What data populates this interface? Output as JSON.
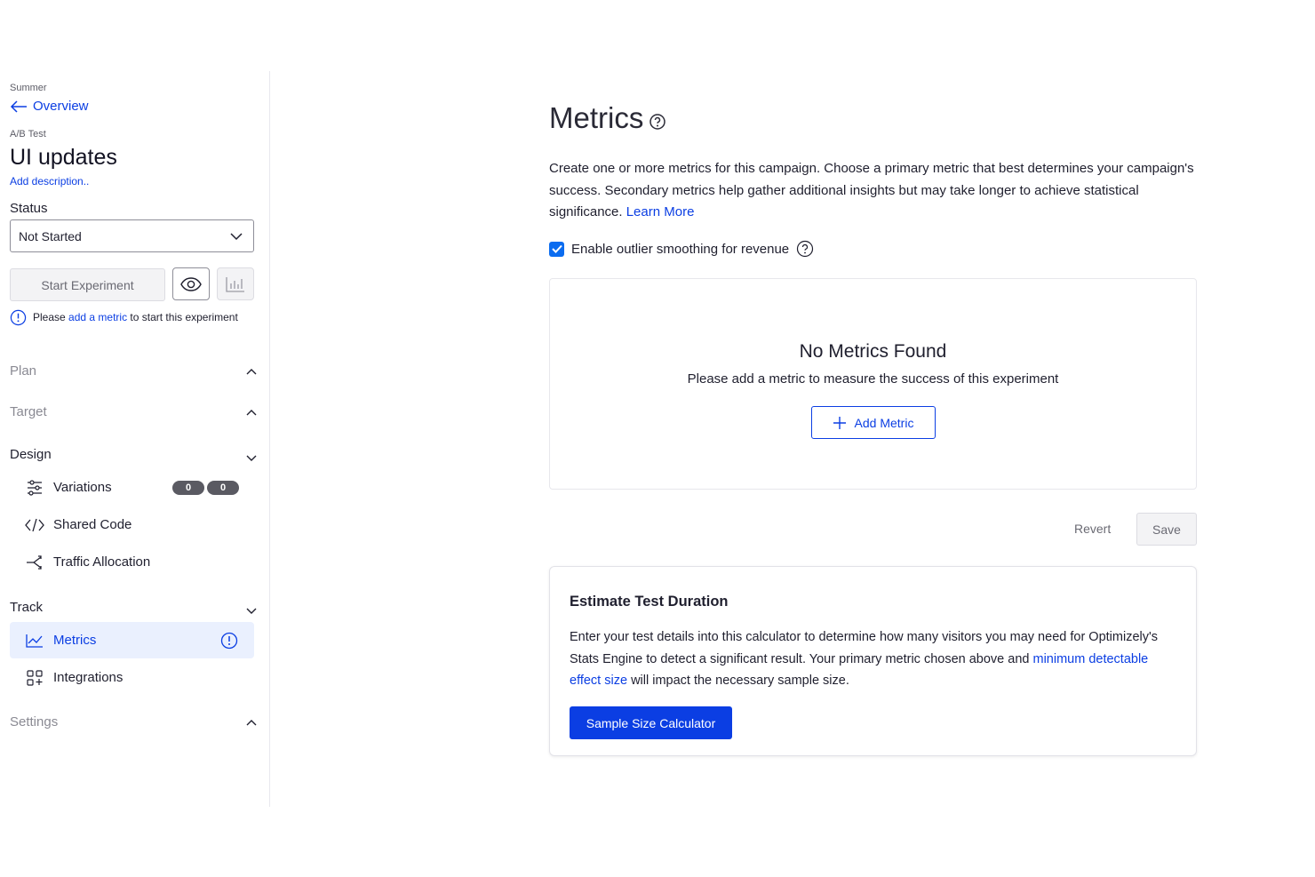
{
  "colors": {
    "accent": "#0b3ee3",
    "active_bg": "#eaf0fe",
    "badge": "#5a5a62"
  },
  "sidebar": {
    "project": "Summer",
    "back_label": "Overview",
    "experiment_type": "A/B Test",
    "experiment_name": "UI updates",
    "add_description": "Add description..",
    "status_label": "Status",
    "status_value": "Not Started",
    "start_button": "Start Experiment",
    "warning": {
      "prefix": "Please",
      "link": "add a metric",
      "suffix": "to start this experiment"
    },
    "sections": {
      "plan": "Plan",
      "target": "Target",
      "design": "Design",
      "track": "Track",
      "settings": "Settings"
    },
    "design_items": {
      "variations": {
        "label": "Variations",
        "badges": [
          "0",
          "0"
        ]
      },
      "shared_code": "Shared Code",
      "traffic_allocation": "Traffic Allocation"
    },
    "track_items": {
      "metrics": "Metrics",
      "integrations": "Integrations"
    }
  },
  "main": {
    "title": "Metrics",
    "description": "Create one or more metrics for this campaign. Choose a primary metric that best determines your campaign's success. Secondary metrics help gather additional insights but may take longer to achieve statistical significance.",
    "learn_more": "Learn More",
    "outlier_label": "Enable outlier smoothing for revenue",
    "outlier_checked": true,
    "empty_title": "No Metrics Found",
    "empty_subtitle": "Please add a metric to measure the success of this experiment",
    "add_metric": "Add Metric",
    "revert": "Revert",
    "save": "Save",
    "estimate": {
      "title": "Estimate Test Duration",
      "body_1": "Enter your test details into this calculator to determine how many visitors you may need for Optimizely's Stats Engine to detect a significant result. Your primary metric chosen above and",
      "link": "minimum detectable effect size",
      "body_2": "will impact the necessary sample size.",
      "button": "Sample Size Calculator"
    }
  }
}
